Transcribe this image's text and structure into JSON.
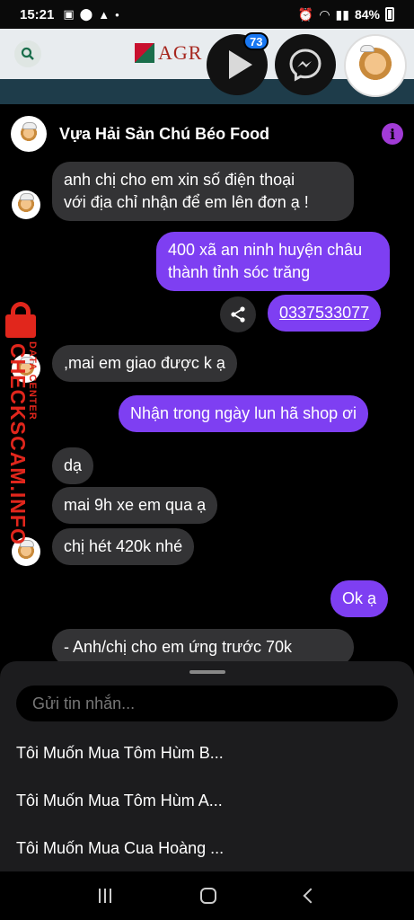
{
  "status_bar": {
    "time": "15:21",
    "battery": "84%"
  },
  "background_page": {
    "logo_text": "AGR"
  },
  "chat_heads": {
    "badge_count": "73"
  },
  "chat": {
    "title": "Vựa Hải Sản Chú Béo Food",
    "messages": [
      {
        "from": "page",
        "lines": [
          "anh chị cho em xin số điện thoại",
          "với địa chỉ nhận  để em lên đơn ạ !"
        ]
      },
      {
        "from": "user",
        "lines": [
          "400 xã an ninh huyện châu",
          "thành tỉnh sóc trăng"
        ]
      },
      {
        "from": "user",
        "lines": [
          "0337533077"
        ]
      },
      {
        "from": "page",
        "lines": [
          ",mai em giao được k ạ"
        ]
      },
      {
        "from": "user",
        "lines": [
          "Nhận trong ngày lun hã shop ơi"
        ]
      },
      {
        "from": "page",
        "lines": [
          "dạ"
        ]
      },
      {
        "from": "page",
        "lines": [
          "mai 9h xe em qua ạ"
        ]
      },
      {
        "from": "page",
        "lines": [
          "chị hét 420k nhé"
        ]
      },
      {
        "from": "user",
        "lines": [
          "Ok ạ"
        ]
      },
      {
        "from": "page",
        "lines": [
          "- Anh/chị cho em ứng trước 70k"
        ]
      }
    ]
  },
  "composer": {
    "placeholder": "Gửi tin nhắn...",
    "quick_replies": [
      "Tôi Muốn Mua Tôm Hùm B...",
      "Tôi Muốn Mua Tôm Hùm A...",
      "Tôi Muốn Mua Cua Hoàng ..."
    ]
  },
  "watermark": {
    "brand": "CHECKSCAM.INFO",
    "sub": "DATA CENTER"
  },
  "colors": {
    "outgoing_bubble": "#7e3ff2",
    "incoming_bubble": "#333335",
    "info_icon": "#a13bd6",
    "watermark": "#e1261c"
  }
}
